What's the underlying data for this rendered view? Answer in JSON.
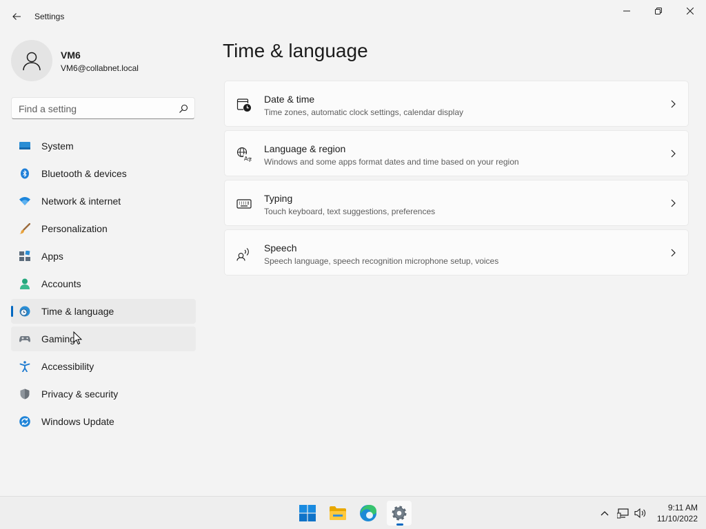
{
  "window": {
    "title": "Settings"
  },
  "profile": {
    "name": "VM6",
    "email": "VM6@collabnet.local"
  },
  "search": {
    "placeholder": "Find a setting"
  },
  "sidebar": {
    "items": [
      {
        "label": "System",
        "icon": "system-icon"
      },
      {
        "label": "Bluetooth & devices",
        "icon": "bluetooth-icon"
      },
      {
        "label": "Network & internet",
        "icon": "wifi-icon"
      },
      {
        "label": "Personalization",
        "icon": "brush-icon"
      },
      {
        "label": "Apps",
        "icon": "apps-icon"
      },
      {
        "label": "Accounts",
        "icon": "person-icon"
      },
      {
        "label": "Time & language",
        "icon": "globe-clock-icon",
        "selected": true
      },
      {
        "label": "Gaming",
        "icon": "gamepad-icon"
      },
      {
        "label": "Accessibility",
        "icon": "accessibility-icon"
      },
      {
        "label": "Privacy & security",
        "icon": "shield-icon"
      },
      {
        "label": "Windows Update",
        "icon": "update-icon"
      }
    ]
  },
  "main": {
    "title": "Time & language",
    "cards": [
      {
        "title": "Date & time",
        "desc": "Time zones, automatic clock settings, calendar display",
        "icon": "calendar-clock-icon"
      },
      {
        "title": "Language & region",
        "desc": "Windows and some apps format dates and time based on your region",
        "icon": "language-icon"
      },
      {
        "title": "Typing",
        "desc": "Touch keyboard, text suggestions, preferences",
        "icon": "keyboard-icon"
      },
      {
        "title": "Speech",
        "desc": "Speech language, speech recognition microphone setup, voices",
        "icon": "speech-icon"
      }
    ]
  },
  "taskbar": {
    "clock_time": "9:11 AM",
    "clock_date": "11/10/2022"
  },
  "colors": {
    "accent": "#0067c0",
    "background": "#f3f3f3"
  }
}
